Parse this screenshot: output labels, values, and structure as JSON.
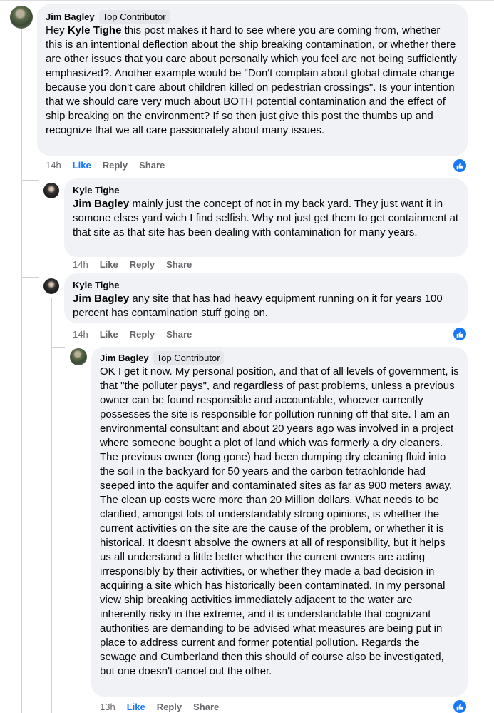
{
  "comments": [
    {
      "author": "Jim Bagley",
      "badge": "Top Contributor",
      "mention": "Kyle Tighe",
      "text_before": "Hey ",
      "text_after": " this post makes it hard to see where you are coming from, whether this is an intentional deflection about the ship breaking contamination, or whether there are other issues that you care about personally which you feel are not being sufficiently emphasized?. Another example would be \"Don't complain about global climate change because you don't care about children killed on pedestrian crossings\". Is your intention that we should care very much about BOTH potential contamination and the effect of ship breaking on the environment? If so then just give this post the thumbs up and recognize that we all care passionately about many issues.",
      "time": "14h",
      "like": "Like",
      "reply": "Reply",
      "share": "Share",
      "reaction_icon": "thumbs-up-icon"
    },
    {
      "author": "Kyle Tighe",
      "mention": "Jim Bagley",
      "text": " mainly just the concept of not in my back yard. They just want it in somone elses yard wich I find selfish. Why not just get them to get containment at that site as that site has been dealing with contamination for many years.",
      "time": "14h",
      "like": "Like",
      "reply": "Reply",
      "share": "Share"
    },
    {
      "author": "Kyle Tighe",
      "mention": "Jim Bagley",
      "text": " any site that has had heavy equipment running on it for years 100 percent has contamination stuff going on.",
      "time": "14h",
      "like": "Like",
      "reply": "Reply",
      "share": "Share",
      "reaction_icon": "thumbs-up-icon"
    },
    {
      "author": "Jim Bagley",
      "badge": "Top Contributor",
      "text": "OK I get it now. My personal position, and that of all levels of government, is that \"the polluter pays\", and regardless of past problems, unless a previous owner can be found responsible and accountable, whoever currently possesses the site is responsible for pollution running off that site. I am an environmental consultant and about 20 years ago was involved in a project where someone bought a plot of land which was formerly a dry cleaners. The previous owner (long gone) had been dumping dry cleaning fluid into the soil in the backyard for 50 years and the carbon tetrachloride had seeped into the aquifer and contaminated sites as far as 900 meters away. The clean up costs were more than 20 Million dollars. What needs to be clarified, amongst lots of understandably strong opinions, is whether the current activities on the site are the cause of the problem, or whether it is historical. It doesn't absolve the owners at all of responsibility, but it helps us all understand a little better whether the current owners are acting irresponsibly by their activities, or whether they made a bad decision in acquiring a site which has historically been contaminated. In my personal view ship breaking activities immediately adjacent to the water are inherently risky in the extreme, and it is understandable that cognizant authorities are demanding to be advised what measures are being put in place to address current and former potential pollution. Regards the sewage and Cumberland then this should of course also be investigated, but one doesn't cancel out the other.",
      "time": "13h",
      "like": "Like",
      "reply": "Reply",
      "share": "Share",
      "reaction_icon": "thumbs-up-icon"
    }
  ],
  "colors": {
    "like_active": "#1877f2",
    "bubble_bg": "#f0f2f5",
    "meta_text": "#65676b"
  }
}
